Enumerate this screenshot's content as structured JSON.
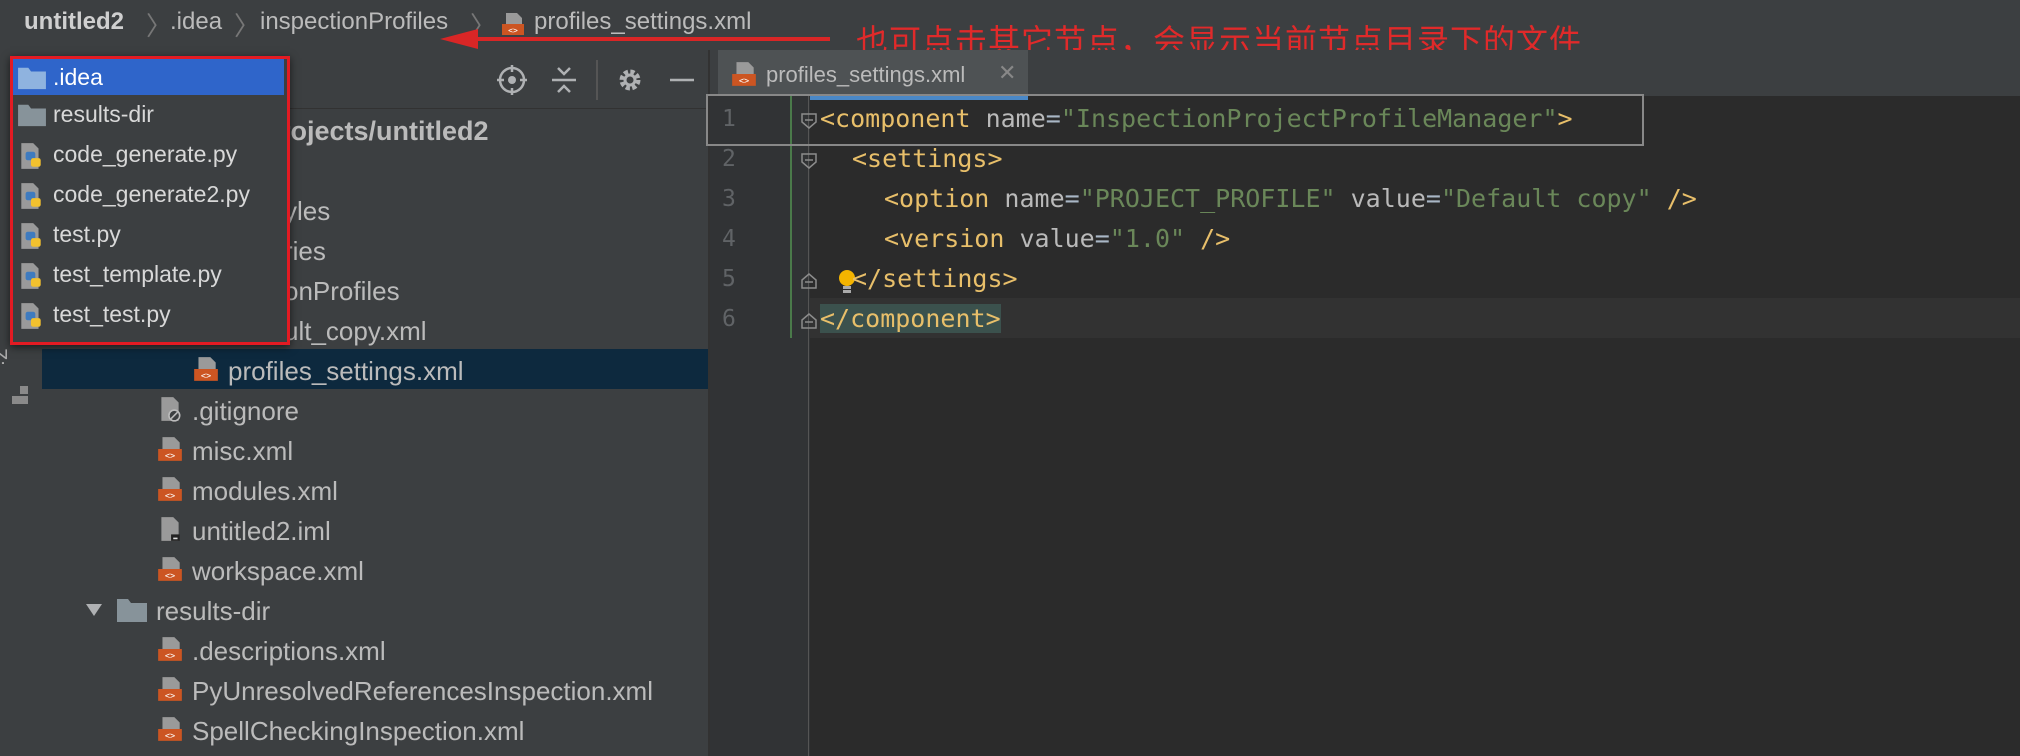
{
  "breadcrumb": {
    "items": [
      "untitled2",
      ".idea",
      "inspectionProfiles",
      "profiles_settings.xml"
    ]
  },
  "annotation": {
    "text": "也可点击其它节点，会显示当前节点目录下的文件",
    "color": "#d92626"
  },
  "toolstrip": {
    "label": "Z:"
  },
  "project_panel": {
    "root_text": "rojects/untitled2",
    "partial_rows": [
      "yles",
      "ries",
      "onProfiles",
      "ult_copy.xml"
    ],
    "rows": [
      {
        "label": "profiles_settings.xml",
        "icon": "xml-file-icon",
        "selected": true
      },
      {
        "label": ".gitignore",
        "icon": "ignore-file-icon"
      },
      {
        "label": "misc.xml",
        "icon": "xml-file-icon"
      },
      {
        "label": "modules.xml",
        "icon": "xml-file-icon"
      },
      {
        "label": "untitled2.iml",
        "icon": "iml-file-icon"
      },
      {
        "label": "workspace.xml",
        "icon": "xml-file-icon"
      },
      {
        "label": "results-dir",
        "icon": "folder-icon",
        "expanded": true
      },
      {
        "label": ".descriptions.xml",
        "icon": "xml-file-icon"
      },
      {
        "label": "PyUnresolvedReferencesInspection.xml",
        "icon": "xml-file-icon"
      },
      {
        "label": "SpellCheckingInspection.xml",
        "icon": "xml-file-icon"
      }
    ]
  },
  "popup": {
    "items": [
      {
        "label": ".idea",
        "icon": "folder-icon",
        "selected": true
      },
      {
        "label": "results-dir",
        "icon": "folder-icon"
      },
      {
        "label": "code_generate.py",
        "icon": "python-file-icon"
      },
      {
        "label": "code_generate2.py",
        "icon": "python-file-icon"
      },
      {
        "label": "test.py",
        "icon": "python-file-icon"
      },
      {
        "label": "test_template.py",
        "icon": "python-file-icon"
      },
      {
        "label": "test_test.py",
        "icon": "python-file-icon"
      }
    ]
  },
  "editor": {
    "tab_label": "profiles_settings.xml",
    "line_numbers": [
      "1",
      "2",
      "3",
      "4",
      "5",
      "6"
    ],
    "code": {
      "l1_open": "<component",
      "l1_attr": " name",
      "l1_eq": "=",
      "l1_val": "\"InspectionProjectProfileManager\"",
      "l1_close": ">",
      "l2": "<settings>",
      "l3_open": "<option",
      "l3_attr1": " name",
      "l3_eq1": "=",
      "l3_val1": "\"PROJECT_PROFILE\"",
      "l3_attr2": " value",
      "l3_eq2": "=",
      "l3_val2": "\"Default copy\"",
      "l3_close": " />",
      "l4_open": "<version",
      "l4_attr": " value",
      "l4_eq": "=",
      "l4_val": "\"1.0\"",
      "l4_close": " />",
      "l5": "</settings>",
      "l6": "</component>"
    }
  }
}
